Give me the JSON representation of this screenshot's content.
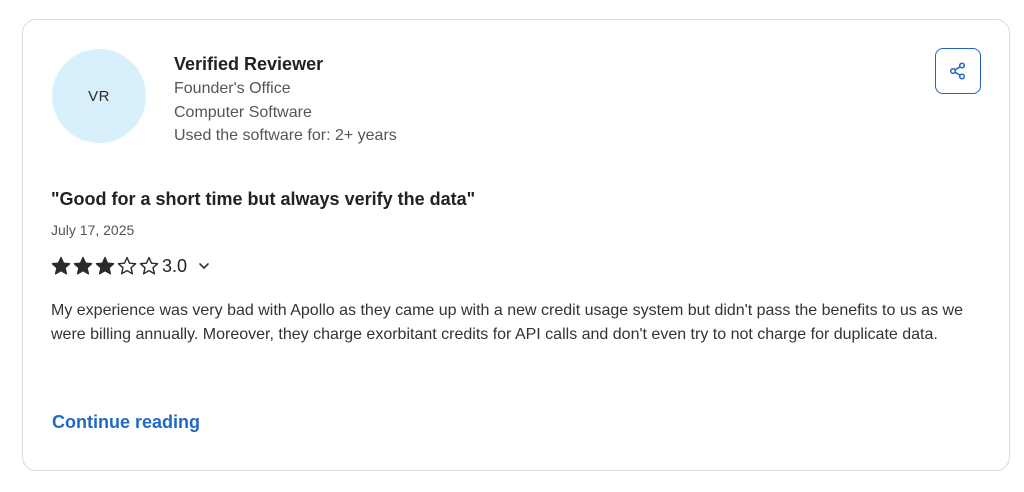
{
  "reviewer": {
    "initials": "VR",
    "name": "Verified Reviewer",
    "role": "Founder's Office",
    "industry": "Computer Software",
    "usage": "Used the software for: 2+ years"
  },
  "share": {
    "icon": "share-icon",
    "color": "#2563c9"
  },
  "review": {
    "title": "\"Good for a short time but always verify the data\"",
    "date": "July 17, 2025",
    "rating": 3,
    "rating_max": 5,
    "rating_label": "3.0",
    "body": "My experience was very bad with Apollo as they came up with a new credit usage system but didn't pass the benefits to us as we were billing annually. Moreover, they charge exorbitant credits for API calls and don't even try to not charge for duplicate data."
  },
  "continue_label": "Continue reading",
  "colors": {
    "accent": "#2169c9",
    "avatar_bg": "#d8f0fb",
    "star": "#2b2b2b"
  }
}
